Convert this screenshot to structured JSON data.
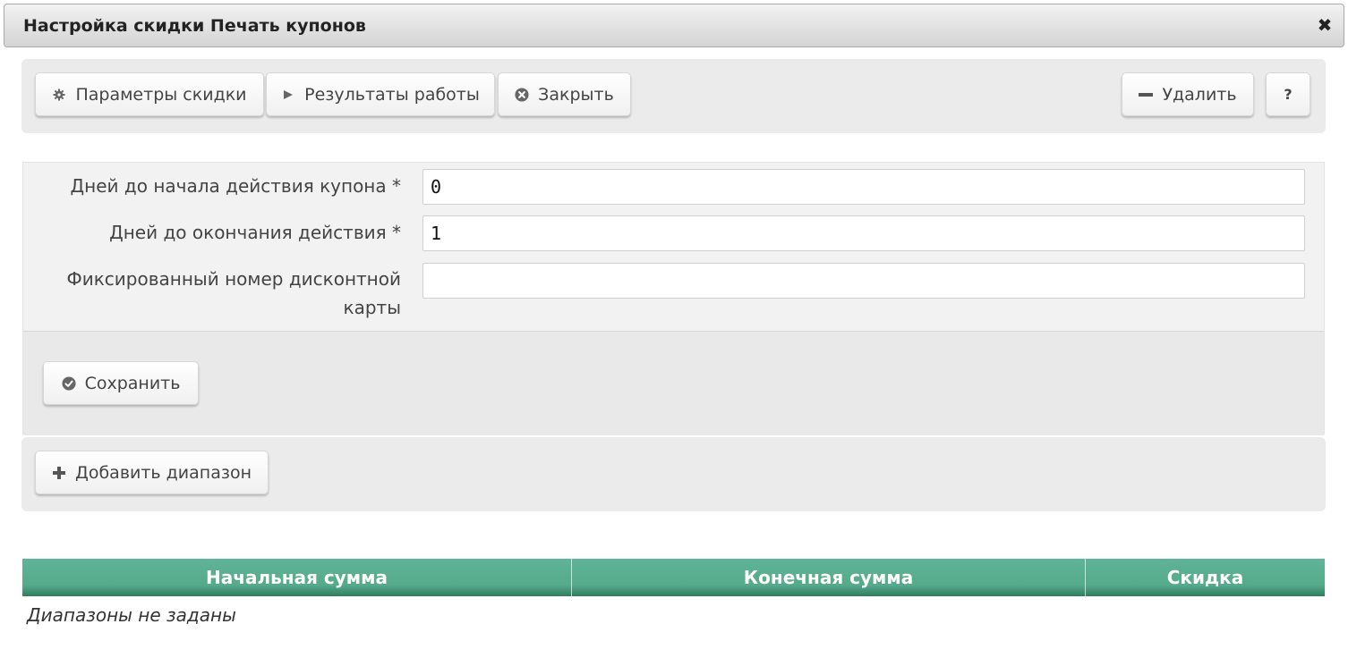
{
  "dialog": {
    "title": "Настройка скидки Печать купонов",
    "close_glyph": "✖"
  },
  "toolbar": {
    "params_label": "Параметры скидки",
    "params_icon": "gear-icon",
    "results_label": "Результаты работы",
    "results_icon": "play-icon",
    "close_label": "Закрыть",
    "close_icon": "close-circle-icon",
    "delete_label": "Удалить",
    "delete_icon": "minus-icon",
    "help_label": "?"
  },
  "form": {
    "fields": [
      {
        "label": "Дней до начала действия купона *",
        "value": "0"
      },
      {
        "label": "Дней до окончания действия *",
        "value": "1"
      },
      {
        "label": "Фиксированный номер дисконтной карты",
        "value": ""
      }
    ],
    "save_label": "Сохранить",
    "save_icon": "check-circle-icon"
  },
  "ranges": {
    "add_label": "Добавить диапазон",
    "add_icon": "plus-icon",
    "columns": [
      "Начальная сумма",
      "Конечная сумма",
      "Скидка"
    ],
    "empty_text": "Диапазоны не заданы"
  },
  "colors": {
    "table_header": "#56aa8c",
    "panel_bg": "#ebebeb"
  }
}
